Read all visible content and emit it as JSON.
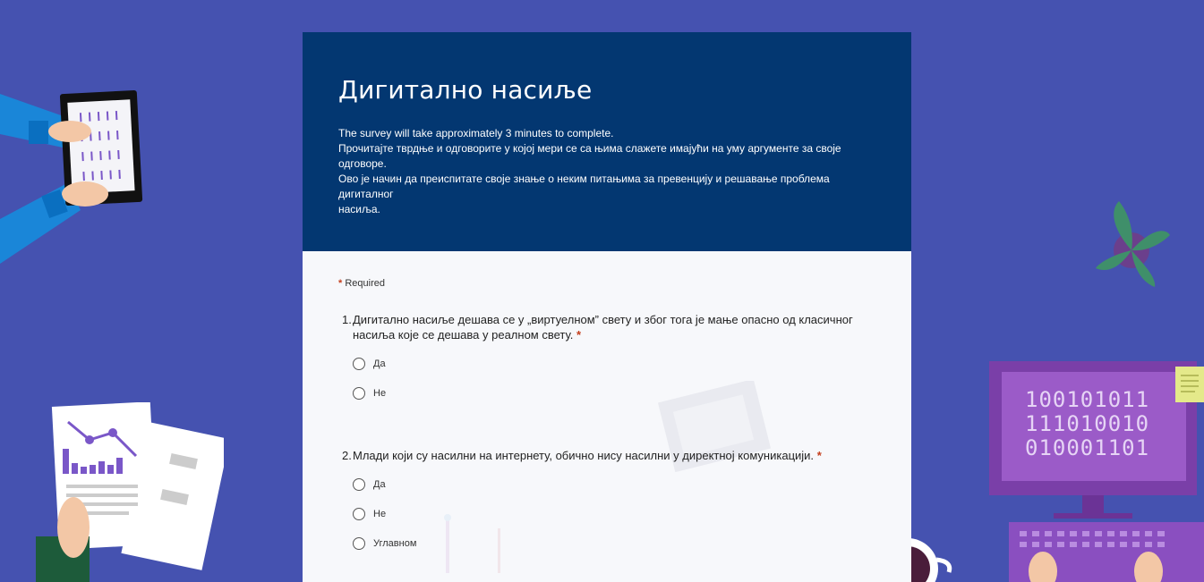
{
  "form": {
    "title": "Дигитално насиље",
    "description": [
      "The survey will take approximately 3 minutes to complete.",
      "Прочитајте тврдње и одговорите у којој мери се са њима слажете имајући на уму аргументе за своје одговоре.",
      "Ово је начин да преиспитате своје знање о неким питањима за превенцију и решавање проблема дигиталног\nнасиља."
    ],
    "required_label": "Required",
    "required_marker": "*"
  },
  "questions": [
    {
      "number": "1.",
      "text": "Дигитално насиље дешава се у „виртуелном” свету и због тога је мање опасно од класичног насиља које се дешава у реалном свету.",
      "required": "*",
      "options": [
        "Да",
        "Не"
      ]
    },
    {
      "number": "2.",
      "text": "Млади који су насилни на интернету, обично нису насилни у директној комуникацији.",
      "required": "*",
      "options": [
        "Да",
        "Не",
        "Углавном"
      ]
    }
  ],
  "decor": {
    "monitor_binary": [
      "100101011",
      "111010010",
      "010001101"
    ],
    "tablet_binary": [
      "1001",
      "0101",
      "1001",
      "0101",
      "1001"
    ],
    "colors": {
      "background": "#4552b0",
      "header": "#033771",
      "body": "#f7f8fb",
      "monitor": "#7a3fa8",
      "required": "#c43e1c"
    }
  }
}
